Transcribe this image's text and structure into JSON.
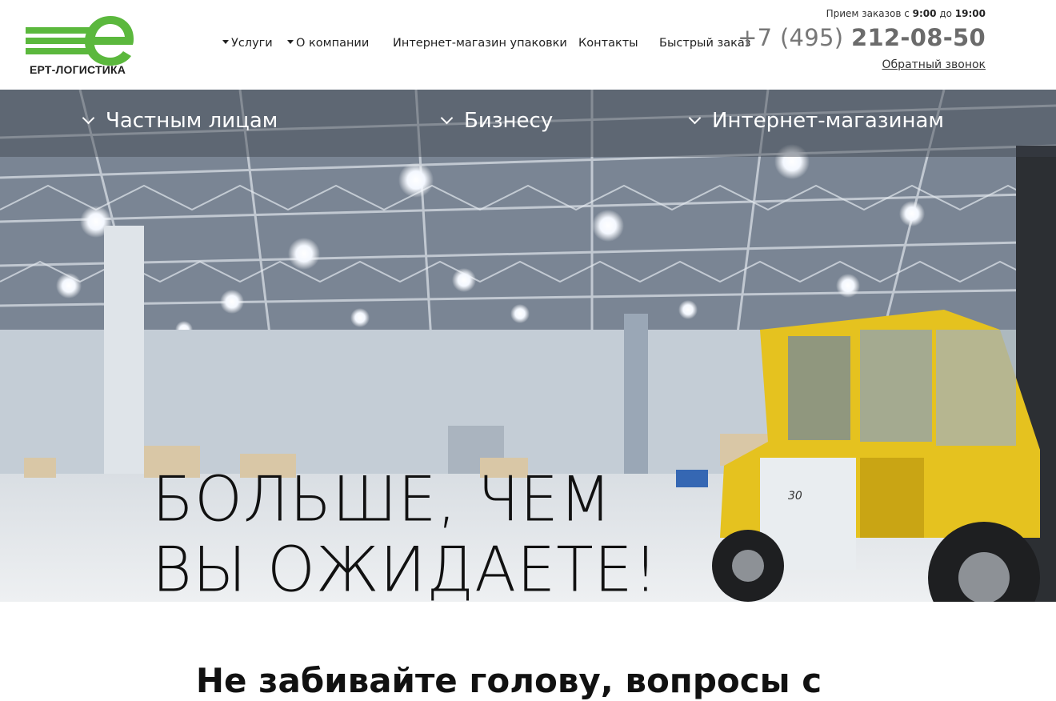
{
  "brand": {
    "name": "ЕРТ-ЛОГИСТИКА",
    "accent_color": "#5bb83d"
  },
  "nav": {
    "items": [
      {
        "label": "Услуги",
        "has_dropdown": true
      },
      {
        "label": "О компании",
        "has_dropdown": true
      },
      {
        "label": "Интернет-магазин упаковки",
        "has_dropdown": false
      },
      {
        "label": "Контакты",
        "has_dropdown": false
      },
      {
        "label": "Быстрый заказ",
        "has_dropdown": false
      }
    ]
  },
  "contact": {
    "hours_prefix": "Прием заказов с",
    "hours_from": "9:00",
    "hours_mid": "до",
    "hours_to": "19:00",
    "phone_code": "+7 (495)",
    "phone_number": "212-08-50",
    "callback_label": "Обратный звонок"
  },
  "segments": [
    {
      "label": "Частным лицам"
    },
    {
      "label": "Бизнесу"
    },
    {
      "label": "Интернет-магазинам"
    }
  ],
  "hero": {
    "line1": "БОЛЬШЕ, ЧЕМ",
    "line2": "ВЫ ОЖИДАЕТЕ!",
    "forklift_badge": "30"
  },
  "section": {
    "heading": "Не забивайте голову, вопросы с"
  }
}
